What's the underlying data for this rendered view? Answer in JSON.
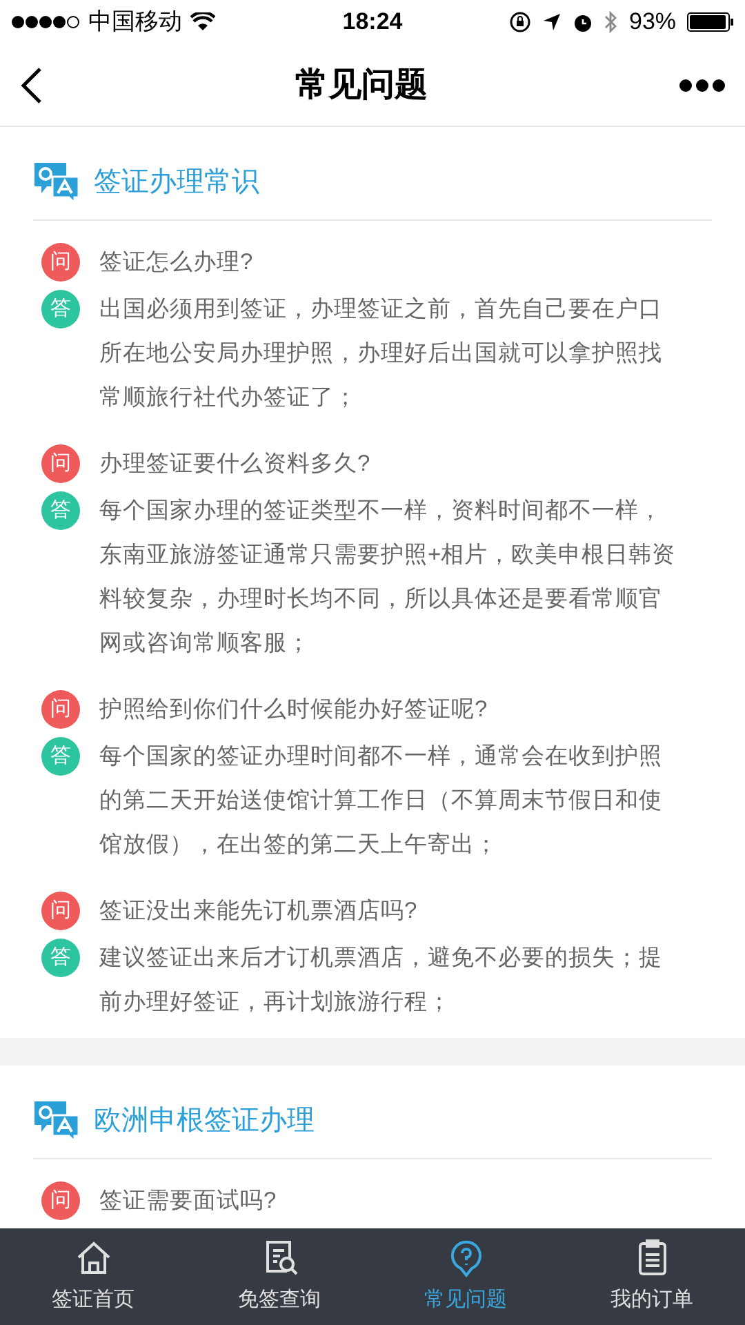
{
  "status_bar": {
    "carrier": "中国移动",
    "time": "18:24",
    "battery": "93%"
  },
  "nav": {
    "title": "常见问题"
  },
  "sections": [
    {
      "title": "签证办理常识",
      "items": [
        {
          "q_badge": "问",
          "question": "签证怎么办理?",
          "a_badge": "答",
          "answer": "出国必须用到签证，办理签证之前，首先自己要在户口所在地公安局办理护照，办理好后出国就可以拿护照找常顺旅行社代办签证了；"
        },
        {
          "q_badge": "问",
          "question": "办理签证要什么资料多久?",
          "a_badge": "答",
          "answer": "每个国家办理的签证类型不一样，资料时间都不一样，东南亚旅游签证通常只需要护照+相片，欧美申根日韩资料较复杂，办理时长均不同，所以具体还是要看常顺官网或咨询常顺客服；"
        },
        {
          "q_badge": "问",
          "question": "护照给到你们什么时候能办好签证呢?",
          "a_badge": "答",
          "answer": "每个国家的签证办理时间都不一样，通常会在收到护照的第二天开始送使馆计算工作日（不算周末节假日和使馆放假），在出签的第二天上午寄出；"
        },
        {
          "q_badge": "问",
          "question": "签证没出来能先订机票酒店吗?",
          "a_badge": "答",
          "answer": "建议签证出来后才订机票酒店，避免不必要的损失；提前办理好签证，再计划旅游行程；"
        }
      ]
    },
    {
      "title": "欧洲申根签证办理",
      "items": [
        {
          "q_badge": "问",
          "question": "签证需要面试吗?"
        }
      ]
    }
  ],
  "tabs": [
    {
      "kind": "home",
      "label": "签证首页",
      "selected": false
    },
    {
      "kind": "search",
      "label": "免签查询",
      "selected": false
    },
    {
      "kind": "help",
      "label": "常见问题",
      "selected": true
    },
    {
      "kind": "clipboard",
      "label": "我的订单",
      "selected": false
    }
  ]
}
